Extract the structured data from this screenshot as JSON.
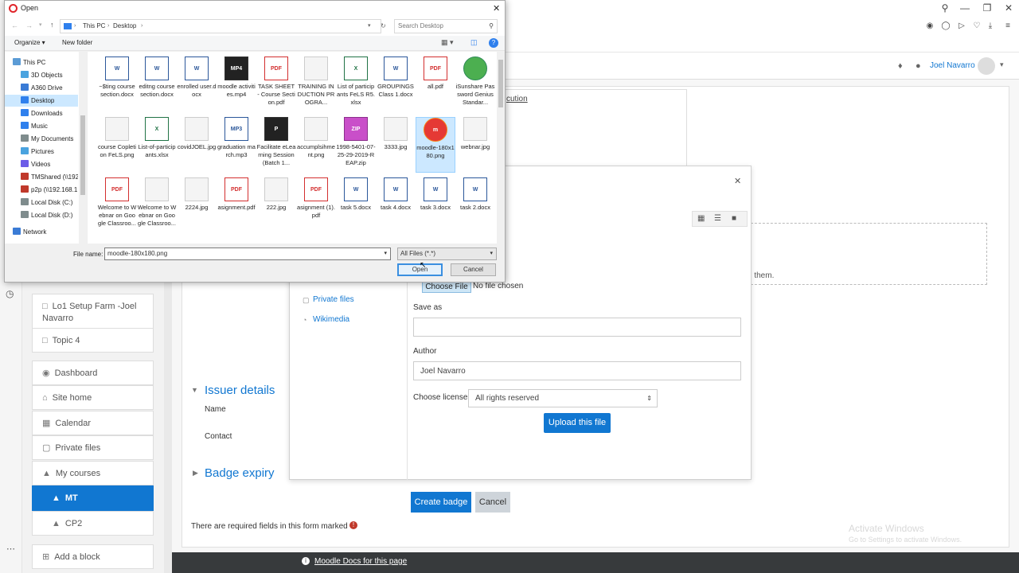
{
  "browser": {
    "toolbar_icons": [
      "search-icon",
      "minimize-icon",
      "restore-icon",
      "close-icon"
    ],
    "ext_icons": [
      "camera-icon",
      "shield-icon",
      "send-icon",
      "heart-icon",
      "download-icon",
      "menu-icon"
    ]
  },
  "moodle": {
    "user_name": "Joel Navarro",
    "partial_link": "cution",
    "drawer_items": [
      {
        "label": "Lo1 Setup Farm -Joel Navarro",
        "icon": "folder-icon"
      },
      {
        "label": "Topic 4",
        "icon": "folder-icon"
      },
      {
        "label": "Dashboard",
        "icon": "dashboard-icon"
      },
      {
        "label": "Site home",
        "icon": "home-icon"
      },
      {
        "label": "Calendar",
        "icon": "calendar-icon"
      },
      {
        "label": "Private files",
        "icon": "file-icon"
      },
      {
        "label": "My courses",
        "icon": "graduation-cap-icon"
      },
      {
        "label": "MT",
        "icon": "graduation-cap-icon"
      },
      {
        "label": "CP2",
        "icon": "graduation-cap-icon"
      },
      {
        "label": "Add a block",
        "icon": "plus-icon"
      }
    ],
    "issuer_details": "Issuer details",
    "name_label": "Name",
    "contact_label": "Contact",
    "badge_expiry": "Badge expiry",
    "create_badge": "Create badge",
    "cancel": "Cancel",
    "required_note": "There are required fields in this form marked",
    "docs_link": "Moodle Docs for this page",
    "drop_text_tail": "d them.",
    "watermark_line1": "Activate Windows",
    "watermark_line2": "Go to Settings to activate Windows."
  },
  "file_picker": {
    "repos": [
      "Private files",
      "Wikimedia"
    ],
    "choose_file": "Choose File",
    "no_file": "No file chosen",
    "save_as_label": "Save as",
    "save_as_value": "",
    "author_label": "Author",
    "author_value": "Joel Navarro",
    "license_label": "Choose license",
    "license_value": "All rights reserved",
    "upload_button": "Upload this file"
  },
  "dialog": {
    "title": "Open",
    "breadcrumb": [
      "This PC",
      "Desktop"
    ],
    "search_placeholder": "Search Desktop",
    "organize": "Organize ▾",
    "new_folder": "New folder",
    "tree": [
      {
        "label": "This PC",
        "color": "#5b9bd5",
        "sel": false,
        "indent": 0
      },
      {
        "label": "3D Objects",
        "color": "#4aa3df",
        "sel": false,
        "indent": 1
      },
      {
        "label": "A360 Drive",
        "color": "#3a7bd5",
        "sel": false,
        "indent": 1
      },
      {
        "label": "Desktop",
        "color": "#2f80ed",
        "sel": true,
        "indent": 1
      },
      {
        "label": "Downloads",
        "color": "#2f80ed",
        "sel": false,
        "indent": 1
      },
      {
        "label": "Music",
        "color": "#2f80ed",
        "sel": false,
        "indent": 1
      },
      {
        "label": "My Documents",
        "color": "#7f8c8d",
        "sel": false,
        "indent": 1
      },
      {
        "label": "Pictures",
        "color": "#4aa3df",
        "sel": false,
        "indent": 1
      },
      {
        "label": "Videos",
        "color": "#6c5ce7",
        "sel": false,
        "indent": 1
      },
      {
        "label": "TMShared (\\\\192",
        "color": "#c0392b",
        "sel": false,
        "indent": 1
      },
      {
        "label": "p2p (\\\\192.168.1",
        "color": "#c0392b",
        "sel": false,
        "indent": 1
      },
      {
        "label": "Local Disk (C:)",
        "color": "#7f8c8d",
        "sel": false,
        "indent": 1
      },
      {
        "label": "Local Disk (D:)",
        "color": "#7f8c8d",
        "sel": false,
        "indent": 1
      },
      {
        "label": "Network",
        "color": "#3a7bd5",
        "sel": false,
        "indent": 0
      }
    ],
    "files": [
      {
        "name": "~$ting course section.docx",
        "kind": "word",
        "tag": "W"
      },
      {
        "name": "editng course section.docx",
        "kind": "word",
        "tag": "W"
      },
      {
        "name": "enrolled user.docx",
        "kind": "word",
        "tag": "W"
      },
      {
        "name": "moodle activities.mp4",
        "kind": "mp",
        "tag": "MP4"
      },
      {
        "name": "TASK SHEET - Course Section.pdf",
        "kind": "pdf",
        "tag": "PDF"
      },
      {
        "name": "TRAINING INDUCTION PROGRA...",
        "kind": "img",
        "tag": ""
      },
      {
        "name": "List of participants FeLS R5.xlsx",
        "kind": "excel",
        "tag": "X"
      },
      {
        "name": "GROUPINGS Class 1.docx",
        "kind": "word",
        "tag": "W"
      },
      {
        "name": "all.pdf",
        "kind": "pdf",
        "tag": "PDF"
      },
      {
        "name": "iSunshare Password Genius Standar...",
        "kind": "exe",
        "tag": ""
      },
      {
        "name": "course Copletion FeLS.png",
        "kind": "img",
        "tag": ""
      },
      {
        "name": "List-of-participants.xlsx",
        "kind": "excel",
        "tag": "X"
      },
      {
        "name": "covidJOEL.jpg",
        "kind": "img",
        "tag": ""
      },
      {
        "name": "graduation march.mp3",
        "kind": "word",
        "tag": "MP3"
      },
      {
        "name": "Facilitate eLearning Session (Batch 1...",
        "kind": "mp",
        "tag": "P"
      },
      {
        "name": "accumplsihment.png",
        "kind": "img",
        "tag": ""
      },
      {
        "name": "1998-5401-07-25-29-2019-REAP.zip",
        "kind": "zip",
        "tag": "ZIP"
      },
      {
        "name": "3333.jpg",
        "kind": "img",
        "tag": ""
      },
      {
        "name": "moodle-180x180.png",
        "kind": "moodle",
        "tag": "m"
      },
      {
        "name": "webnar.jpg",
        "kind": "img",
        "tag": ""
      },
      {
        "name": "Welcome to Webnar on Google Classroo...",
        "kind": "pdf",
        "tag": "PDF"
      },
      {
        "name": "Welcome to Webnar on Google Classroo...",
        "kind": "img",
        "tag": ""
      },
      {
        "name": "2224.jpg",
        "kind": "img",
        "tag": ""
      },
      {
        "name": "asignment.pdf",
        "kind": "pdf",
        "tag": "PDF"
      },
      {
        "name": "222.jpg",
        "kind": "img",
        "tag": ""
      },
      {
        "name": "asignment (1).pdf",
        "kind": "pdf",
        "tag": "PDF"
      },
      {
        "name": "task 5.docx",
        "kind": "word",
        "tag": "W"
      },
      {
        "name": "task 4.docx",
        "kind": "word",
        "tag": "W"
      },
      {
        "name": "task 3.docx",
        "kind": "word",
        "tag": "W"
      },
      {
        "name": "task 2.docx",
        "kind": "word",
        "tag": "W"
      }
    ],
    "selected_file": "moodle-180x180.png",
    "file_name_label": "File name:",
    "file_name_value": "moodle-180x180.png",
    "filter_value": "All Files (*.*)",
    "open_button": "Open",
    "cancel_button": "Cancel"
  }
}
